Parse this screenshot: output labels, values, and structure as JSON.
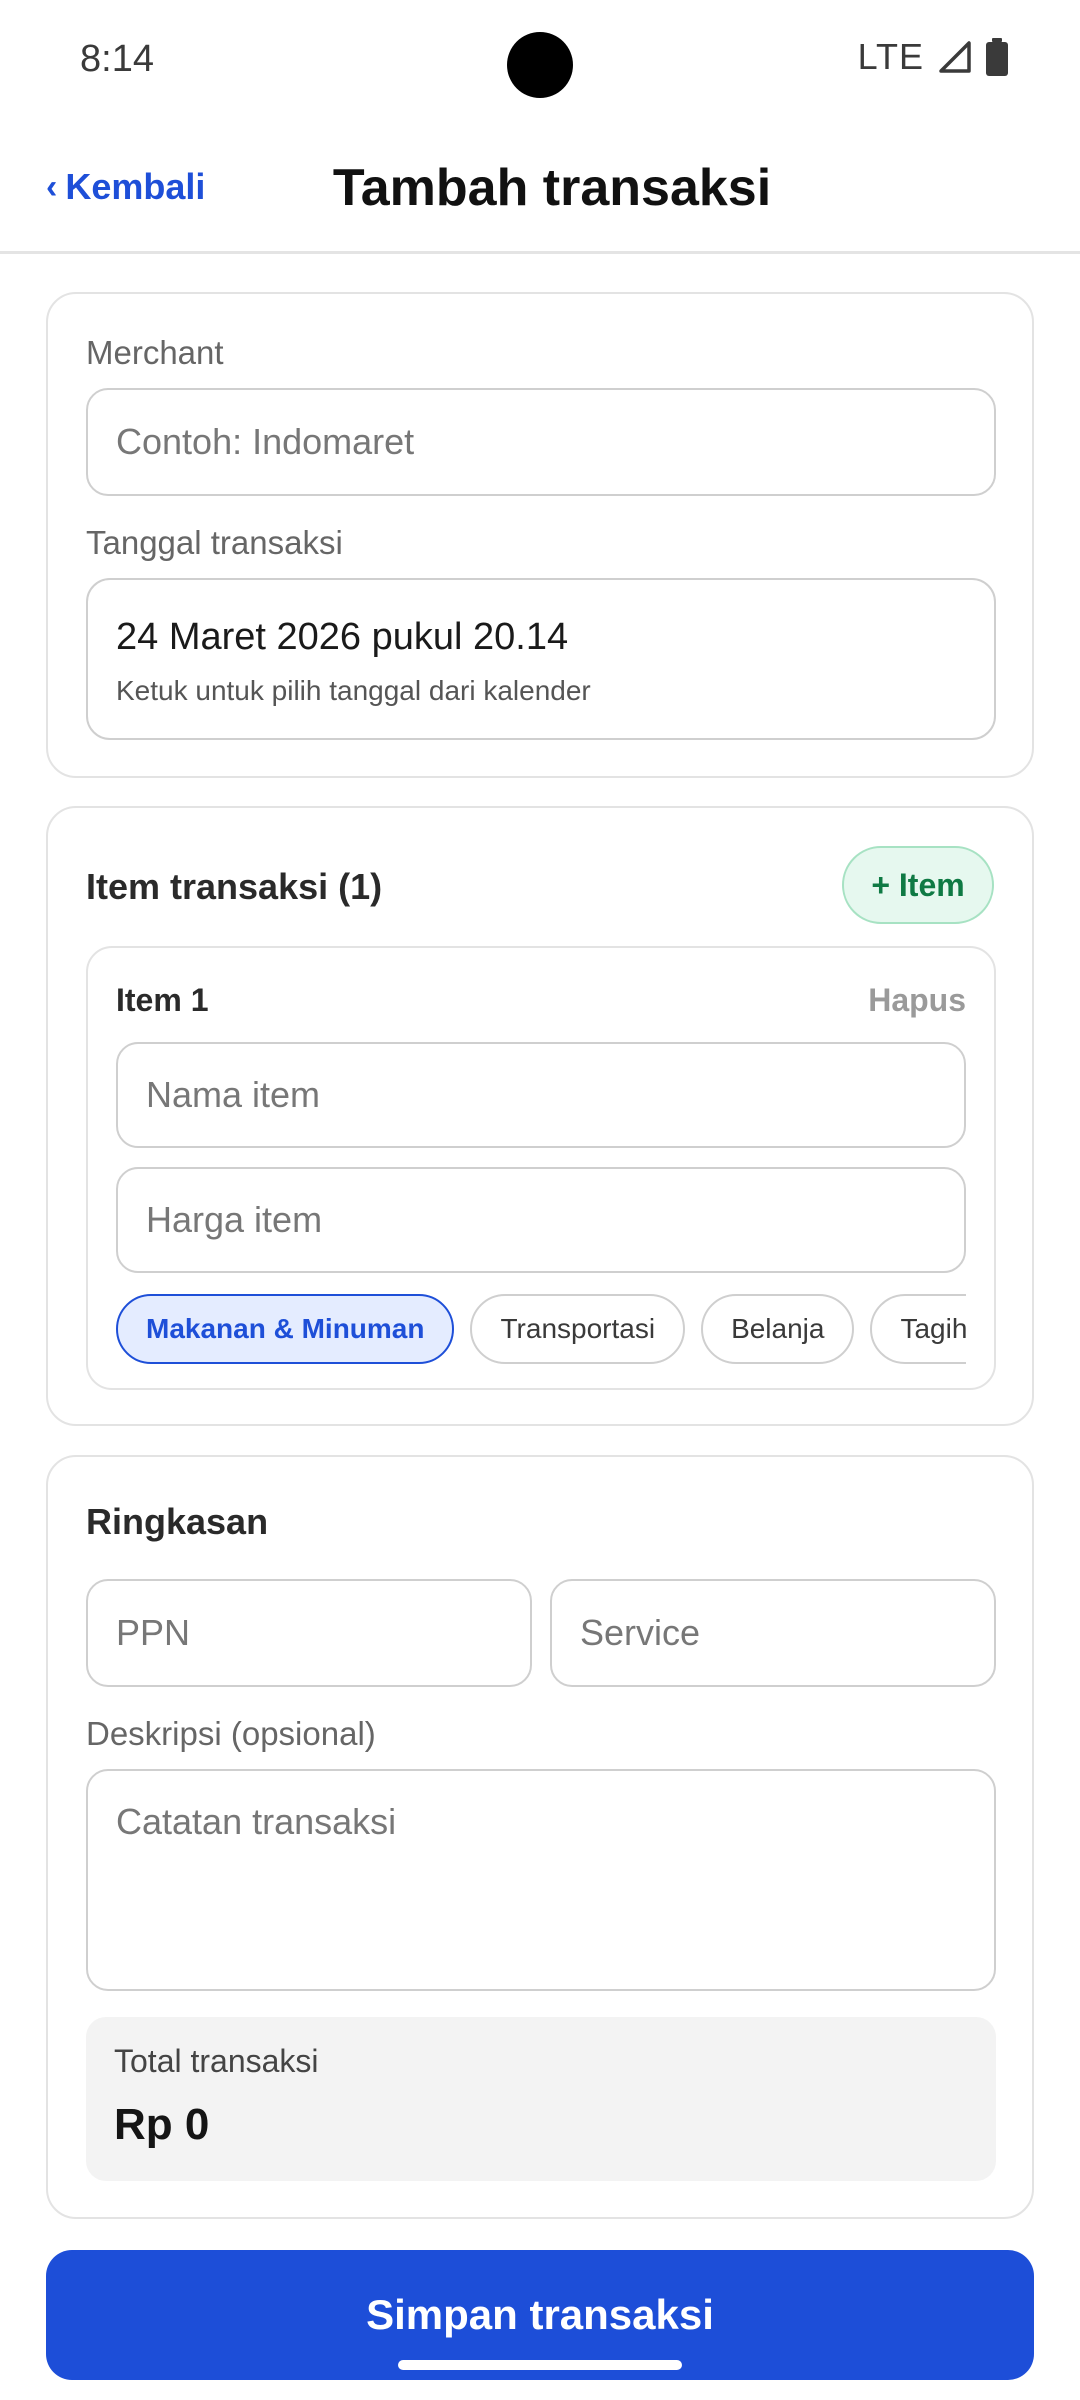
{
  "status_bar": {
    "time": "8:14",
    "network": "LTE",
    "icons": [
      "signal-icon",
      "battery-icon"
    ]
  },
  "header": {
    "back_chevron": "‹",
    "back_label": "Kembali",
    "title": "Tambah transaksi"
  },
  "details": {
    "merchant_label": "Merchant",
    "merchant_placeholder": "Contoh: Indomaret",
    "date_label": "Tanggal transaksi",
    "date_value": "24 Maret 2026 pukul 20.14",
    "date_hint": "Ketuk untuk pilih tanggal dari kalender"
  },
  "items": {
    "title": "Item transaksi (1)",
    "add_label": "+ Item",
    "list": [
      {
        "title": "Item 1",
        "delete_label": "Hapus",
        "name_placeholder": "Nama item",
        "price_placeholder": "Harga item",
        "categories": [
          "Makanan & Minuman",
          "Transportasi",
          "Belanja",
          "Tagihan"
        ],
        "selected_category": "Makanan & Minuman"
      }
    ]
  },
  "summary": {
    "title": "Ringkasan",
    "ppn_placeholder": "PPN",
    "service_placeholder": "Service",
    "description_label": "Deskripsi (opsional)",
    "description_placeholder": "Catatan transaksi",
    "total_label": "Total transaksi",
    "total_value": "Rp 0"
  },
  "save_label": "Simpan transaksi",
  "colors": {
    "primary": "#1d4ed8",
    "add_item_bg": "#e6f8ef",
    "add_item_text": "#0f7a44",
    "chip_selected_bg": "#e4ecff"
  }
}
